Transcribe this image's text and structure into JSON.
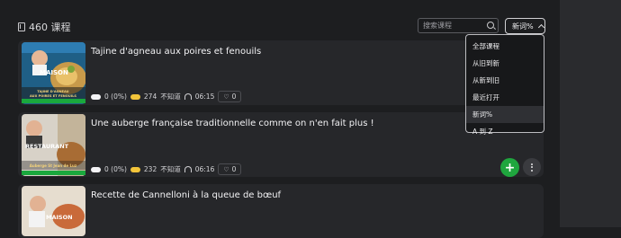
{
  "header": {
    "count_label": "460 课程"
  },
  "search": {
    "placeholder": "搜索课程"
  },
  "sort": {
    "current": "新词%"
  },
  "dropdown": {
    "options": [
      "全部课程",
      "从旧到新",
      "从新到旧",
      "最近打开",
      "新词%",
      "A 到 Z"
    ],
    "selected_index": 4
  },
  "courses": [
    {
      "title": "Tajine d'agneau aux poires et fenouils",
      "thumb_main": "MAISON",
      "thumb_caption": "TAJINE D'AGNEAU AUX POIRES ET FENOUILS",
      "known": "0 (0%)",
      "lingqs": "274",
      "status": "不知道",
      "duration": "06:15",
      "likes": "0"
    },
    {
      "title": "Une auberge française traditionnelle comme on n'en fait plus !",
      "thumb_main": "RESTAURANT",
      "thumb_caption": "Auberge St Jean de Luz",
      "known": "0 (0%)",
      "lingqs": "232",
      "status": "不知道",
      "duration": "06:16",
      "likes": "0"
    },
    {
      "title": "Recette de Cannelloni à la queue de bœuf",
      "thumb_main": "MAISON"
    }
  ],
  "colors": {
    "accent_green": "#1fa63e",
    "lingq_yellow": "#f2c43a",
    "bg": "#1d1e20",
    "card": "#26272a"
  }
}
